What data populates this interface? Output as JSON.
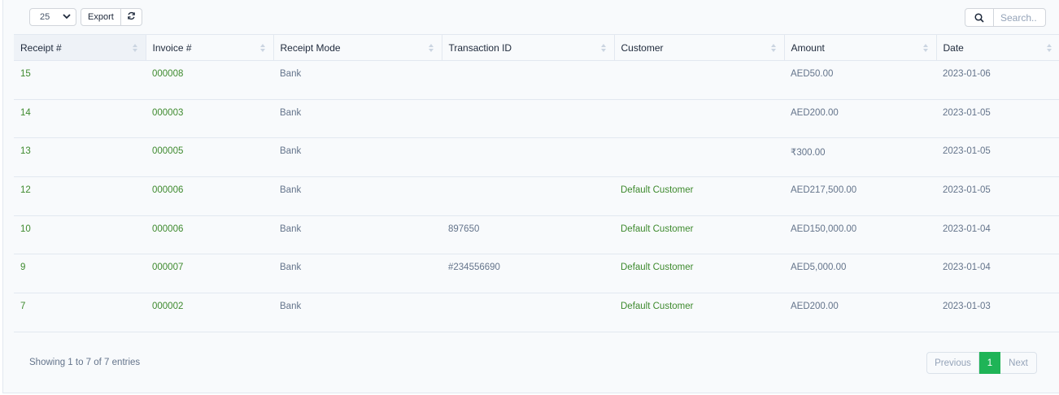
{
  "toolbar": {
    "page_length": "25",
    "export_label": "Export"
  },
  "search": {
    "placeholder": "Search.."
  },
  "columns": [
    "Receipt #",
    "Invoice #",
    "Receipt Mode",
    "Transaction ID",
    "Customer",
    "Amount",
    "Date"
  ],
  "rows": [
    {
      "receipt": "15",
      "invoice": "000008",
      "mode": "Bank",
      "txn": "",
      "customer": "",
      "amount": "AED50.00",
      "date": "2023-01-06"
    },
    {
      "receipt": "14",
      "invoice": "000003",
      "mode": "Bank",
      "txn": "",
      "customer": "",
      "amount": "AED200.00",
      "date": "2023-01-05"
    },
    {
      "receipt": "13",
      "invoice": "000005",
      "mode": "Bank",
      "txn": "",
      "customer": "",
      "amount": "₹300.00",
      "date": "2023-01-05"
    },
    {
      "receipt": "12",
      "invoice": "000006",
      "mode": "Bank",
      "txn": "",
      "customer": "Default Customer",
      "amount": "AED217,500.00",
      "date": "2023-01-05"
    },
    {
      "receipt": "10",
      "invoice": "000006",
      "mode": "Bank",
      "txn": "897650",
      "customer": "Default Customer",
      "amount": "AED150,000.00",
      "date": "2023-01-04"
    },
    {
      "receipt": "9",
      "invoice": "000007",
      "mode": "Bank",
      "txn": "#234556690",
      "customer": "Default Customer",
      "amount": "AED5,000.00",
      "date": "2023-01-04"
    },
    {
      "receipt": "7",
      "invoice": "000002",
      "mode": "Bank",
      "txn": "",
      "customer": "Default Customer",
      "amount": "AED200.00",
      "date": "2023-01-03"
    }
  ],
  "footer": {
    "info": "Showing 1 to 7 of 7 entries",
    "previous": "Previous",
    "current_page": "1",
    "next": "Next"
  },
  "colors": {
    "link": "#3e8a2e",
    "active_page": "#1fb457"
  }
}
